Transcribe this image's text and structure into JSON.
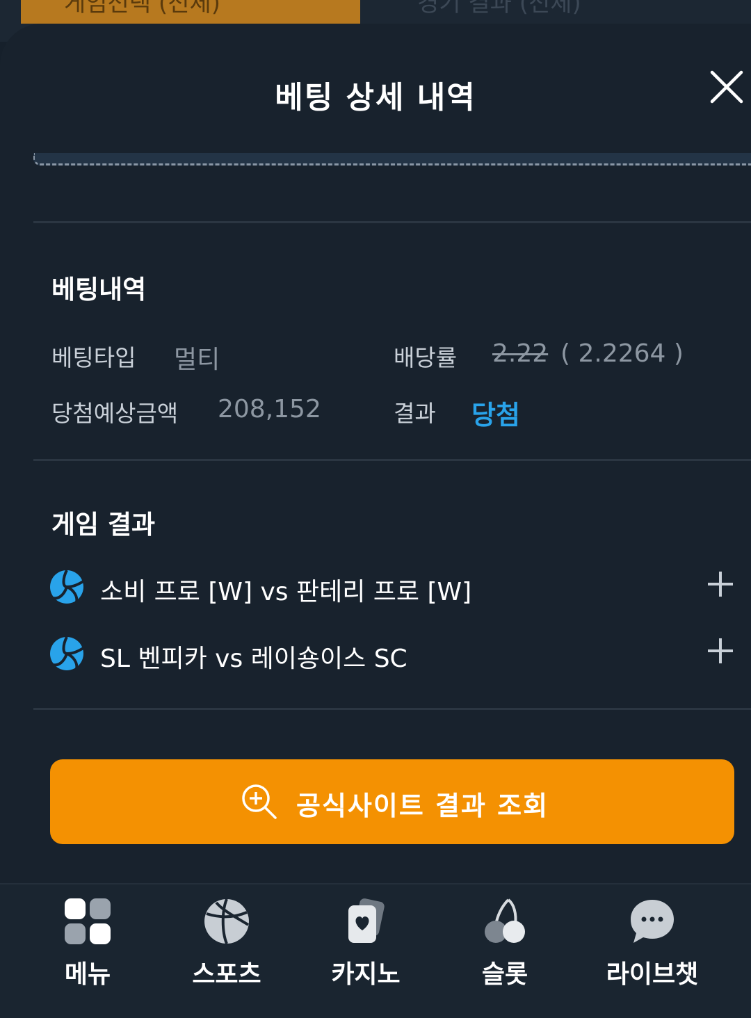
{
  "background": {
    "dropdown_label": "게임선택 (전체)",
    "dropdown2_label": "경기 결과 (전체)"
  },
  "sheet": {
    "title": "베팅 상세 내역",
    "close_icon": "close-icon"
  },
  "bet_info": {
    "section_title": "베팅내역",
    "bet_type_label": "베팅타입",
    "bet_type_value": "멀티",
    "odds_label": "배당률",
    "odds_original": "2.22",
    "odds_actual": "( 2.2264 )",
    "expected_label": "당첨예상금액",
    "expected_value": "208,152",
    "result_label": "결과",
    "result_value": "당첨"
  },
  "game_results": {
    "section_title": "게임 결과",
    "games": [
      {
        "name": "소비 프로 [W] vs 판테리 프로 [W]",
        "icon": "volleyball-icon"
      },
      {
        "name": "SL 벤피카 vs 레이숑이스 SC",
        "icon": "volleyball-icon"
      }
    ]
  },
  "cta": {
    "label": "공식사이트 결과 조회",
    "icon": "zoom-in-icon"
  },
  "bottom_nav": {
    "items": [
      {
        "label": "메뉴",
        "icon": "grid-icon"
      },
      {
        "label": "스포츠",
        "icon": "basketball-icon"
      },
      {
        "label": "카지노",
        "icon": "cards-icon"
      },
      {
        "label": "슬롯",
        "icon": "cherry-icon"
      },
      {
        "label": "라이브챗",
        "icon": "chat-icon"
      }
    ]
  },
  "colors": {
    "accent": "#f49102",
    "win": "#29a3ea",
    "background": "#18222d"
  }
}
